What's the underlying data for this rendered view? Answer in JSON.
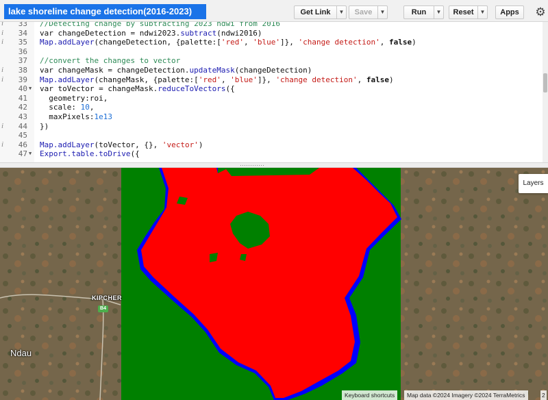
{
  "app": {
    "title": "lake shoreline change detection(2016-2023)"
  },
  "toolbar": {
    "get_link_label": "Get Link",
    "save_label": "Save",
    "run_label": "Run",
    "reset_label": "Reset",
    "apps_label": "Apps",
    "settings_icon": "gear-icon"
  },
  "editor": {
    "lines": [
      {
        "num": "33",
        "info": true,
        "fold": false,
        "parts": [
          [
            "comment",
            "//Detecting change by subtracting 2023 ndwi from 2016"
          ]
        ]
      },
      {
        "num": "34",
        "info": true,
        "fold": false,
        "parts": [
          [
            "kw",
            "var changeDetection = ndwi2023."
          ],
          [
            "fn",
            "subtract"
          ],
          [
            "kw",
            "(ndwi2016)"
          ]
        ]
      },
      {
        "num": "35",
        "info": true,
        "fold": false,
        "parts": [
          [
            "fn",
            "Map.addLayer"
          ],
          [
            "kw",
            "(changeDetection, {palette:["
          ],
          [
            "str",
            "'red'"
          ],
          [
            "kw",
            ", "
          ],
          [
            "str",
            "'blue'"
          ],
          [
            "kw",
            "]}, "
          ],
          [
            "str",
            "'change detection'"
          ],
          [
            "kw",
            ", "
          ],
          [
            "bool",
            "false"
          ],
          [
            "kw",
            ")"
          ]
        ]
      },
      {
        "num": "36",
        "info": false,
        "fold": false,
        "parts": []
      },
      {
        "num": "37",
        "info": false,
        "fold": false,
        "parts": [
          [
            "comment",
            "//convert the changes to vector"
          ]
        ]
      },
      {
        "num": "38",
        "info": true,
        "fold": false,
        "parts": [
          [
            "kw",
            "var changeMask = changeDetection."
          ],
          [
            "fn",
            "updateMask"
          ],
          [
            "kw",
            "(changeDetection)"
          ]
        ]
      },
      {
        "num": "39",
        "info": true,
        "fold": false,
        "parts": [
          [
            "fn",
            "Map.addLayer"
          ],
          [
            "kw",
            "(changeMask, {palette:["
          ],
          [
            "str",
            "'red'"
          ],
          [
            "kw",
            ", "
          ],
          [
            "str",
            "'blue'"
          ],
          [
            "kw",
            "]}, "
          ],
          [
            "str",
            "'change detection'"
          ],
          [
            "kw",
            ", "
          ],
          [
            "bool",
            "false"
          ],
          [
            "kw",
            ")"
          ]
        ]
      },
      {
        "num": "40",
        "info": false,
        "fold": true,
        "parts": [
          [
            "kw",
            "var toVector = changeMask."
          ],
          [
            "fn",
            "reduceToVectors"
          ],
          [
            "kw",
            "({"
          ]
        ]
      },
      {
        "num": "41",
        "info": false,
        "fold": false,
        "parts": [
          [
            "kw",
            "  geometry:roi,"
          ]
        ]
      },
      {
        "num": "42",
        "info": false,
        "fold": false,
        "parts": [
          [
            "kw",
            "  scale: "
          ],
          [
            "num",
            "10"
          ],
          [
            "kw",
            ","
          ]
        ]
      },
      {
        "num": "43",
        "info": false,
        "fold": false,
        "parts": [
          [
            "kw",
            "  maxPixels:"
          ],
          [
            "num",
            "1e13"
          ]
        ]
      },
      {
        "num": "44",
        "info": true,
        "fold": false,
        "parts": [
          [
            "kw",
            "})"
          ]
        ]
      },
      {
        "num": "45",
        "info": false,
        "fold": false,
        "parts": []
      },
      {
        "num": "46",
        "info": true,
        "fold": false,
        "parts": [
          [
            "fn",
            "Map.addLayer"
          ],
          [
            "kw",
            "(toVector, {}, "
          ],
          [
            "str",
            "'vector'"
          ],
          [
            "kw",
            ")"
          ]
        ]
      },
      {
        "num": "47",
        "info": false,
        "fold": true,
        "parts": [
          [
            "fn",
            "Export.table.toDrive"
          ],
          [
            "kw",
            "({"
          ]
        ]
      }
    ]
  },
  "map": {
    "layers_label": "Layers",
    "places": {
      "kipcher": "KIPCHER",
      "road": "B4",
      "ndau": "Ndau"
    },
    "attribution": {
      "shortcuts": "Keyboard shortcuts",
      "data": "Map data ©2024 Imagery ©2024 TerraMetrics",
      "scale": "2"
    },
    "colors": {
      "increase": "#ff0000",
      "decrease": "#0000ff",
      "background": "#008000"
    }
  }
}
